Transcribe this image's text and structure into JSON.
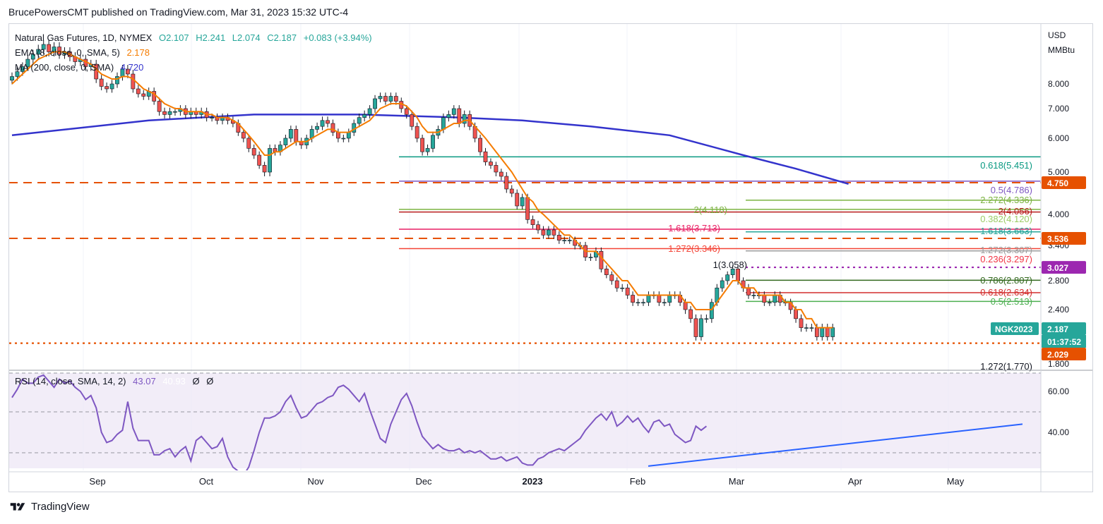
{
  "header": {
    "text": "BrucePowersCMT published on TradingView.com, Mar 31, 2023 15:32 UTC-4"
  },
  "footer": {
    "brand": "TradingView"
  },
  "legend": {
    "symbol": "Natural Gas Futures, 1D, NYMEX",
    "open": "O2.107",
    "high": "H2.241",
    "low": "L2.074",
    "close": "C2.187",
    "change": "+0.083 (+3.94%)",
    "ema_label": "EMA (8, close, 0, SMA, 5)",
    "ema_value": "2.178",
    "ma_label": "MA (200, close, 0, SMA)",
    "ma_value": "4.720",
    "rsi_label": "RSI (14, close, SMA, 14, 2)",
    "rsi_value": "43.07",
    "rsi_ma_value": "40.93",
    "rsi_extra1": "Ø",
    "rsi_extra2": "Ø"
  },
  "axis": {
    "currency": "USD",
    "unit": "MMBtu",
    "price_ticks": [
      "8.000",
      "7.000",
      "6.000",
      "5.000",
      "4.000",
      "3.400",
      "2.800",
      "2.400",
      "1.800"
    ],
    "rsi_ticks": [
      "60.00",
      "40.00"
    ],
    "date_ticks": [
      "Sep",
      "Oct",
      "Nov",
      "Dec",
      "2023",
      "Feb",
      "Mar",
      "Apr",
      "May"
    ]
  },
  "price_tags": [
    {
      "text": "4.750",
      "color": "#e65100"
    },
    {
      "text": "3.536",
      "color": "#e65100"
    },
    {
      "text": "3.027",
      "color": "#9c27b0"
    },
    {
      "text": "2.187",
      "color": "#26a69a"
    },
    {
      "text": "01:37:52",
      "color": "#26a69a"
    },
    {
      "text": "2.029",
      "color": "#e65100"
    }
  ],
  "symbol_tag": "NGK2023",
  "fib_labels": [
    {
      "text": "0.618(5.451)",
      "color": "#089981"
    },
    {
      "text": "0.5(4.786)",
      "color": "#7e57c2"
    },
    {
      "text": "2.272(4.336)",
      "color": "#7cb342"
    },
    {
      "text": "2(4.118)",
      "color": "#7cb342"
    },
    {
      "text": "2(4.056)",
      "color": "#b71c1c"
    },
    {
      "text": "0.382(4.120)",
      "color": "#9ccc65"
    },
    {
      "text": "1.618(3.713)",
      "color": "#e91e63"
    },
    {
      "text": "1.618(3.663)",
      "color": "#26a69a"
    },
    {
      "text": "1.272(3.346)",
      "color": "#f44336"
    },
    {
      "text": "1.272(3.307)",
      "color": "#9e9e9e"
    },
    {
      "text": "0.236(3.297)",
      "color": "#f23645"
    },
    {
      "text": "1(3.058)",
      "color": "#131722"
    },
    {
      "text": "0.786(2.807)",
      "color": "#33691e"
    },
    {
      "text": "0.618(2.634)",
      "color": "#d32f2f"
    },
    {
      "text": "0.5(2.513)",
      "color": "#4caf50"
    },
    {
      "text": "1.272(1.770)",
      "color": "#131722"
    }
  ],
  "chart_data": {
    "type": "candlestick",
    "x": [
      "Aug 12",
      "Aug 15",
      "Aug 16",
      "Aug 17",
      "Aug 18",
      "Aug 19",
      "Aug 22",
      "Aug 23",
      "Aug 24",
      "Aug 25",
      "Aug 26",
      "Aug 29",
      "Aug 30",
      "Aug 31",
      "Sep 1",
      "Sep 2",
      "Sep 6",
      "Sep 7",
      "Sep 8",
      "Sep 9",
      "Sep 12",
      "Sep 13",
      "Sep 14",
      "Sep 15",
      "Sep 16",
      "Sep 19",
      "Sep 20",
      "Sep 21",
      "Sep 22",
      "Sep 23",
      "Sep 26",
      "Sep 27",
      "Sep 28",
      "Sep 29",
      "Sep 30",
      "Oct 3",
      "Oct 4",
      "Oct 5",
      "Oct 6",
      "Oct 7",
      "Oct 10",
      "Oct 11",
      "Oct 12",
      "Oct 13",
      "Oct 14",
      "Oct 17",
      "Oct 18",
      "Oct 19",
      "Oct 20",
      "Oct 21",
      "Oct 24",
      "Oct 25",
      "Oct 26",
      "Oct 27",
      "Oct 28",
      "Oct 31",
      "Nov 1",
      "Nov 2",
      "Nov 3",
      "Nov 4",
      "Nov 7",
      "Nov 8",
      "Nov 9",
      "Nov 10",
      "Nov 11",
      "Nov 14",
      "Nov 15",
      "Nov 16",
      "Nov 17",
      "Nov 18",
      "Nov 21",
      "Nov 22",
      "Nov 23",
      "Nov 25",
      "Nov 28",
      "Nov 29",
      "Nov 30",
      "Dec 1",
      "Dec 2",
      "Dec 5",
      "Dec 6",
      "Dec 7",
      "Dec 8",
      "Dec 9",
      "Dec 12",
      "Dec 13",
      "Dec 14",
      "Dec 15",
      "Dec 16",
      "Dec 19",
      "Dec 20",
      "Dec 21",
      "Dec 22",
      "Dec 23",
      "Dec 27",
      "Dec 28",
      "Dec 29",
      "Dec 30",
      "Jan 3",
      "Jan 4",
      "Jan 5",
      "Jan 6",
      "Jan 9",
      "Jan 10",
      "Jan 11",
      "Jan 12",
      "Jan 13",
      "Jan 17",
      "Jan 18",
      "Jan 19",
      "Jan 20",
      "Jan 23",
      "Jan 24",
      "Jan 25",
      "Jan 26",
      "Jan 27",
      "Jan 30",
      "Jan 31",
      "Feb 1",
      "Feb 2",
      "Feb 3",
      "Feb 6",
      "Feb 7",
      "Feb 8",
      "Feb 9",
      "Feb 10",
      "Feb 13",
      "Feb 14",
      "Feb 15",
      "Feb 16",
      "Feb 17",
      "Feb 21",
      "Feb 22",
      "Feb 23",
      "Feb 24",
      "Feb 27",
      "Feb 28",
      "Mar 1",
      "Mar 2",
      "Mar 3",
      "Mar 6",
      "Mar 7",
      "Mar 8",
      "Mar 9",
      "Mar 10",
      "Mar 13",
      "Mar 14",
      "Mar 15",
      "Mar 16",
      "Mar 17",
      "Mar 20",
      "Mar 21",
      "Mar 22",
      "Mar 23",
      "Mar 24",
      "Mar 27",
      "Mar 28",
      "Mar 29",
      "Mar 30",
      "Mar 31"
    ],
    "close": [
      8.3,
      8.5,
      8.7,
      9.0,
      9.2,
      9.4,
      9.6,
      9.3,
      9.5,
      9.2,
      9.3,
      9.1,
      8.9,
      9.0,
      8.7,
      8.8,
      8.2,
      7.9,
      7.8,
      8.0,
      8.3,
      8.6,
      8.4,
      7.8,
      7.6,
      7.5,
      7.7,
      7.3,
      6.9,
      6.8,
      6.9,
      6.9,
      7.0,
      6.8,
      6.9,
      6.8,
      6.9,
      6.7,
      6.7,
      6.6,
      6.7,
      6.6,
      6.5,
      6.2,
      6.0,
      5.7,
      5.5,
      5.2,
      5.0,
      5.7,
      5.6,
      5.8,
      6.0,
      6.3,
      5.9,
      5.8,
      6.0,
      6.3,
      6.4,
      6.6,
      6.5,
      6.2,
      6.0,
      6.0,
      6.2,
      6.5,
      6.7,
      6.8,
      7.0,
      7.4,
      7.5,
      7.3,
      7.5,
      7.3,
      7.0,
      6.8,
      6.4,
      6.0,
      5.6,
      5.7,
      6.1,
      6.3,
      6.7,
      6.8,
      7.0,
      6.5,
      6.8,
      6.4,
      6.0,
      5.6,
      5.3,
      5.2,
      5.0,
      4.9,
      4.6,
      4.5,
      4.2,
      4.4,
      3.9,
      3.8,
      3.7,
      3.6,
      3.7,
      3.6,
      3.5,
      3.5,
      3.5,
      3.4,
      3.4,
      3.2,
      3.2,
      3.3,
      3.0,
      2.9,
      2.8,
      2.7,
      2.7,
      2.6,
      2.5,
      2.5,
      2.5,
      2.6,
      2.6,
      2.5,
      2.5,
      2.6,
      2.6,
      2.5,
      2.4,
      2.3,
      2.1,
      2.3,
      2.3,
      2.5,
      2.7,
      2.8,
      2.9,
      3.0,
      2.8,
      2.7,
      2.6,
      2.6,
      2.6,
      2.5,
      2.5,
      2.6,
      2.5,
      2.5,
      2.4,
      2.3,
      2.2,
      2.2,
      2.2,
      2.1,
      2.2,
      2.1,
      2.2
    ],
    "ema_8": [
      8.0,
      8.2,
      8.4,
      8.6,
      8.8,
      9.0,
      9.1,
      9.2,
      9.3,
      9.3,
      9.3,
      9.2,
      9.1,
      9.0,
      8.9,
      8.8,
      8.6,
      8.4,
      8.3,
      8.2,
      8.2,
      8.3,
      8.3,
      8.2,
      8.0,
      7.8,
      7.7,
      7.6,
      7.4,
      7.2,
      7.1,
      7.0,
      7.0,
      6.9,
      6.9,
      6.9,
      6.9,
      6.8,
      6.8,
      6.7,
      6.7,
      6.7,
      6.6,
      6.5,
      6.3,
      6.1,
      5.9,
      5.7,
      5.5,
      5.5,
      5.6,
      5.6,
      5.7,
      5.8,
      5.9,
      5.9,
      5.9,
      6.0,
      6.1,
      6.2,
      6.3,
      6.3,
      6.2,
      6.2,
      6.2,
      6.3,
      6.4,
      6.5,
      6.6,
      6.8,
      7.0,
      7.1,
      7.2,
      7.2,
      7.2,
      7.1,
      6.9,
      6.7,
      6.4,
      6.2,
      6.2,
      6.2,
      6.3,
      6.4,
      6.5,
      6.5,
      6.6,
      6.6,
      6.4,
      6.2,
      6.0,
      5.8,
      5.6,
      5.4,
      5.2,
      5.0,
      4.8,
      4.6,
      4.4,
      4.3,
      4.1,
      4.0,
      3.9,
      3.8,
      3.7,
      3.6,
      3.6,
      3.5,
      3.4,
      3.3,
      3.3,
      3.3,
      3.2,
      3.1,
      3.0,
      2.9,
      2.8,
      2.8,
      2.7,
      2.6,
      2.6,
      2.6,
      2.6,
      2.6,
      2.6,
      2.6,
      2.6,
      2.6,
      2.5,
      2.5,
      2.4,
      2.4,
      2.4,
      2.4,
      2.5,
      2.6,
      2.7,
      2.8,
      2.8,
      2.7,
      2.7,
      2.7,
      2.6,
      2.6,
      2.6,
      2.6,
      2.6,
      2.5,
      2.5,
      2.4,
      2.4,
      2.3,
      2.3,
      2.2,
      2.2,
      2.2,
      2.2
    ],
    "ma_200": [
      6.1,
      6.6,
      6.8,
      6.8,
      6.7,
      6.6,
      6.4,
      6.1,
      5.5,
      5.1,
      4.72
    ],
    "ma_200_dates": [
      "Aug 12",
      "Sep 20",
      "Oct 18",
      "Nov 15",
      "Dec 13",
      "Dec 30",
      "Jan 20",
      "Feb 10",
      "Mar 3",
      "Mar 17",
      "Mar 31"
    ],
    "rsi_14": [
      57,
      61,
      66,
      64,
      64,
      67,
      68,
      65,
      62,
      66,
      64,
      65,
      62,
      60,
      56,
      58,
      52,
      40,
      35,
      36,
      39,
      41,
      55,
      42,
      36,
      36,
      36,
      29,
      29,
      31,
      32,
      28,
      31,
      33,
      26,
      36,
      38,
      35,
      32,
      33,
      37,
      28,
      23,
      21,
      19,
      23,
      31,
      40,
      47,
      47,
      48,
      50,
      55,
      58,
      52,
      47,
      48,
      51,
      54,
      55,
      57,
      58,
      62,
      63,
      61,
      58,
      55,
      59,
      51,
      44,
      37,
      35,
      44,
      50,
      56,
      59,
      53,
      45,
      38,
      35,
      32,
      34,
      32,
      31,
      31,
      32,
      30,
      31,
      30,
      31,
      29,
      27,
      27,
      28,
      26,
      27,
      28,
      25,
      24,
      24,
      27,
      28,
      30,
      31,
      32,
      31,
      33,
      35,
      37,
      41,
      44,
      47,
      49,
      46,
      50,
      43,
      45,
      48,
      45,
      47,
      43,
      40,
      45,
      46,
      43,
      44,
      39,
      37,
      35,
      36,
      43,
      41,
      43
    ],
    "rsi_levels": [
      70,
      50,
      30
    ],
    "price_axis_ticks": [
      8.0,
      7.0,
      6.0,
      5.0,
      4.0,
      3.4,
      2.8,
      2.4,
      1.8
    ],
    "horizontal_levels": [
      {
        "value": 4.75,
        "style": "dashed",
        "color": "#e65100"
      },
      {
        "value": 3.536,
        "style": "dashed",
        "color": "#e65100"
      },
      {
        "value": 2.029,
        "style": "dotted",
        "color": "#e65100"
      },
      {
        "value": 3.027,
        "style": "dotted",
        "color": "#9c27b0"
      },
      {
        "value": 5.451,
        "color": "#089981"
      },
      {
        "value": 4.786,
        "color": "#7e57c2"
      },
      {
        "value": 4.336,
        "color": "#7cb342"
      },
      {
        "value": 4.118,
        "color": "#7cb342"
      },
      {
        "value": 4.056,
        "color": "#b71c1c"
      },
      {
        "value": 3.713,
        "color": "#e91e63"
      },
      {
        "value": 3.663,
        "color": "#26a69a"
      },
      {
        "value": 3.346,
        "color": "#f44336"
      },
      {
        "value": 3.307,
        "color": "#9e9e9e"
      },
      {
        "value": 2.807,
        "color": "#33691e"
      },
      {
        "value": 2.634,
        "color": "#d32f2f"
      },
      {
        "value": 2.513,
        "color": "#4caf50"
      }
    ],
    "colors": {
      "up": "#26a69a",
      "down": "#ef5350",
      "ema": "#f57c00",
      "ma": "#3333cc",
      "rsi": "#7e57c2",
      "rsi_ma": "#ffffff",
      "rsi_band": "#ede7f6",
      "trendline": "#2962ff"
    }
  }
}
